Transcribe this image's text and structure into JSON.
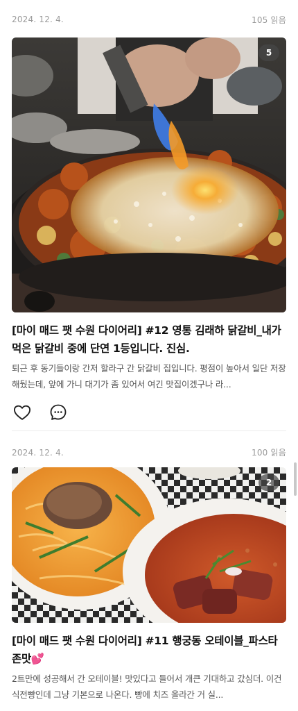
{
  "posts": [
    {
      "date": "2024. 12. 4.",
      "views": "105 읽음",
      "photo_count": "5",
      "title": "[마이 매드 팻 수원 다이어리] #12 영통 김래하 닭갈비_내가 먹은 닭갈비 중에 단연 1등입니다. 진심.",
      "excerpt": "퇴근 후 동기들이랑 간저 할라구 간 닭갈비 집입니다. 평점이 높아서 일단 저장해뒀는데, 앞에 가니 대기가 좀 있어서 여긴 맛집이겠구나 라..."
    },
    {
      "date": "2024. 12. 4.",
      "views": "100 읽음",
      "photo_count": "2",
      "title": "[마이 매드 팻 수원 다이어리] #11 행궁동 오테이블_파스타 존맛💕",
      "excerpt": "2트만에 성공해서 간 오테이블! 맛있다고 들어서 개큰 기대하고 갔심더. 이건 식전빵인데 그냥 기본으로 나온다. 빵에 치즈 올라간 거 실..."
    }
  ],
  "icons": {
    "like": "heart-icon",
    "comment": "comment-bubble-icon"
  },
  "colors": {
    "meta_text": "#9a9a9a",
    "divider": "#ececec",
    "badge_bg": "#464646"
  }
}
